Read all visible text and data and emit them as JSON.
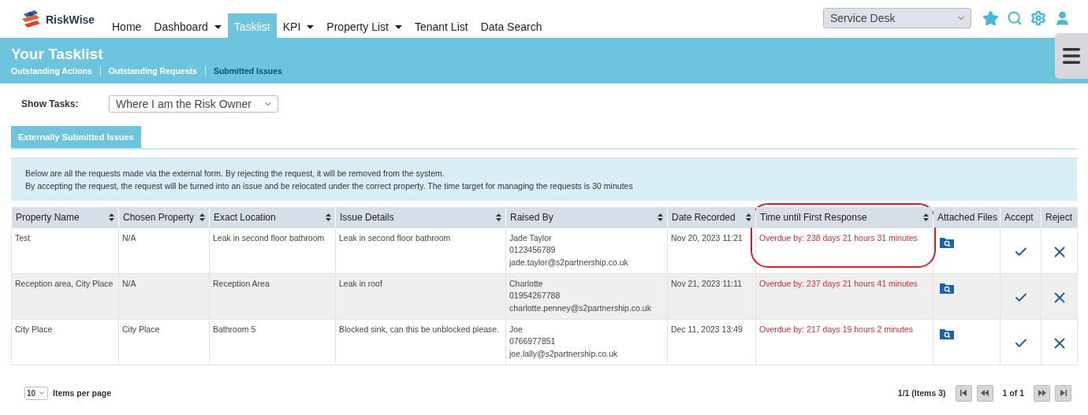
{
  "header": {
    "logo": "RiskWise",
    "nav": [
      {
        "label": "Home",
        "dropdown": false,
        "selected": false
      },
      {
        "label": "Dashboard",
        "dropdown": true,
        "selected": false
      },
      {
        "label": "Tasklist",
        "dropdown": false,
        "selected": true
      },
      {
        "label": "KPI",
        "dropdown": true,
        "selected": false
      },
      {
        "label": "Property List",
        "dropdown": true,
        "selected": false
      },
      {
        "label": "Tenant List",
        "dropdown": false,
        "selected": false
      },
      {
        "label": "Data Search",
        "dropdown": false,
        "selected": false
      }
    ],
    "workspace": {
      "value": "Service Desk"
    }
  },
  "banner": {
    "title": "Your Tasklist",
    "links": [
      {
        "label": "Outstanding Actions",
        "selected": false
      },
      {
        "label": "Outstanding Requests",
        "selected": false
      },
      {
        "label": "Submitted Issues",
        "selected": true
      }
    ]
  },
  "filter": {
    "label": "Show Tasks:",
    "value": "Where I am the Risk Owner"
  },
  "tabs": [
    {
      "label": "Externally Submitted Issues",
      "selected": true
    }
  ],
  "info": [
    "Below are all the requests made via the external form. By rejecting the request, it will be removed from the system.",
    "By accepting the request, the request will be turned into an issue and be relocated under the correct property. The time target for managing the requests is 30 minutes"
  ],
  "table": {
    "columns": [
      {
        "label": "Property Name",
        "sortable": true,
        "circled": false
      },
      {
        "label": "Chosen Property",
        "sortable": true,
        "circled": false
      },
      {
        "label": "Exact Location",
        "sortable": true,
        "circled": false
      },
      {
        "label": "Issue Details",
        "sortable": true,
        "circled": false
      },
      {
        "label": "Raised By",
        "sortable": true,
        "circled": false
      },
      {
        "label": "Date Recorded",
        "sortable": true,
        "circled": false
      },
      {
        "label": "Time until First Response",
        "sortable": true,
        "circled": true
      },
      {
        "label": "Attached Files",
        "sortable": false,
        "circled": false
      },
      {
        "label": "Accept",
        "sortable": false,
        "circled": false
      },
      {
        "label": "Reject",
        "sortable": false,
        "circled": false
      }
    ],
    "rows": [
      {
        "property": "Test",
        "chosen": "N/A",
        "location": "Leak in second floor bathroom",
        "details": "Leak in second floor bathroom",
        "raised_by": [
          "Jade Taylor",
          "0123456789",
          "jade.taylor@s2partnership.co.uk"
        ],
        "date": "Nov 20, 2023 11:21",
        "response": "Overdue by: 238 days 21 hours 31 minutes",
        "overdue": true
      },
      {
        "property": "Reception area, City Place",
        "chosen": "N/A",
        "location": "Reception Area",
        "details": "Leak in roof",
        "raised_by": [
          "Charlotte",
          "01954267788",
          "charlotte.penney@s2partnership.co.uk"
        ],
        "date": "Nov 21, 2023 11:11",
        "response": "Overdue by: 237 days 21 hours 41 minutes",
        "overdue": true
      },
      {
        "property": "City Place",
        "chosen": "City Place",
        "location": "Bathroom 5",
        "details": "Blocked sink, can this be unblocked please.",
        "raised_by": [
          "Joe",
          "0766977851",
          "joe.lally@s2partnership.co.uk"
        ],
        "date": "Dec 11, 2023 13:49",
        "response": "Overdue by: 217 days 19 hours 2 minutes",
        "overdue": true
      }
    ]
  },
  "pager": {
    "page_size": "10",
    "page_size_label": "Items per page",
    "summary": "1/1 (Items 3)",
    "page": "1 of 1"
  }
}
